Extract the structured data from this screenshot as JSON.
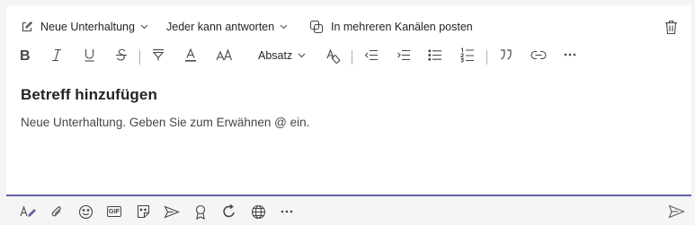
{
  "toolbar_top": {
    "new_conversation_label": "Neue Unterhaltung",
    "reply_permission_label": "Jeder kann antworten",
    "multi_channel_label": "In mehreren Kanälen posten"
  },
  "format_bar": {
    "paragraph_label": "Absatz"
  },
  "compose": {
    "subject_placeholder": "Betreff hinzufügen",
    "body_placeholder": "Neue Unterhaltung. Geben Sie zum Erwähnen @ ein."
  },
  "bottom_bar": {
    "gif_label": "GIF"
  },
  "colors": {
    "accent": "#6264a7",
    "icon": "#484644",
    "text": "#252423"
  }
}
